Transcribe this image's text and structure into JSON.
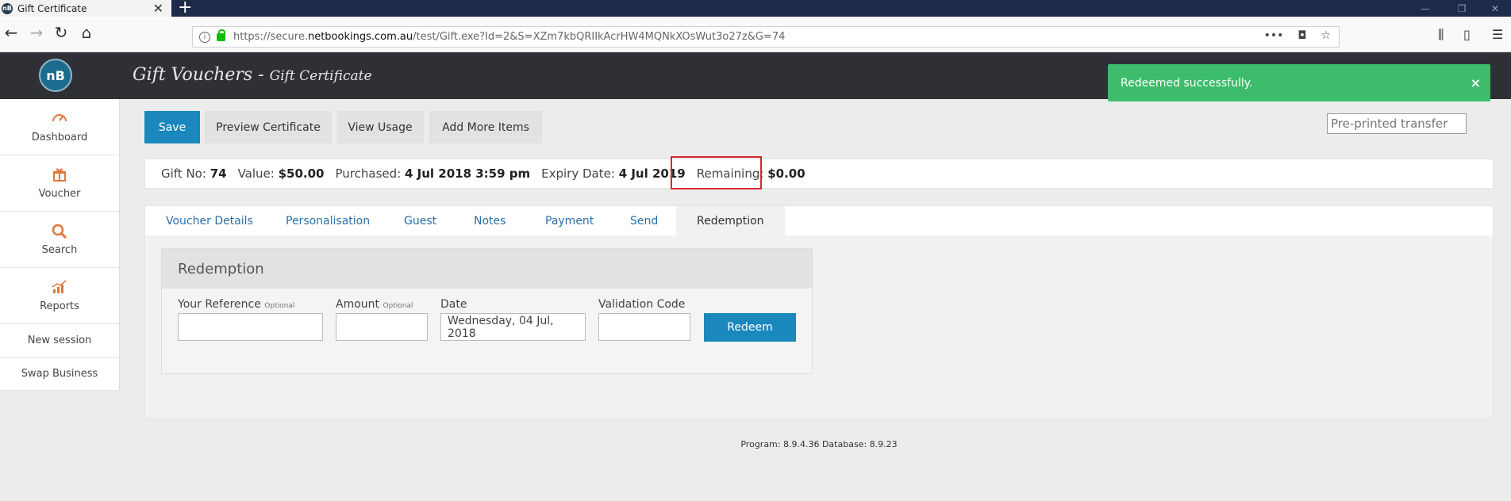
{
  "browser": {
    "tab_title": "Gift Certificate",
    "url_prefix": "https://secure.",
    "url_domain": "netbookings.com.au",
    "url_path": "/test/Gift.exe?Id=2&S=XZm7kbQRIIkAcrHW4MQNkXOsWut3o27z&G=74"
  },
  "header": {
    "logo_text": "nB",
    "title": "Gift Vouchers - ",
    "subtitle": "Gift Certificate"
  },
  "toast": {
    "message": "Redeemed successfully.",
    "close": "×"
  },
  "sidebar": {
    "items": [
      {
        "label": "Dashboard",
        "icon": "dashboard-icon"
      },
      {
        "label": "Voucher",
        "icon": "gift-icon"
      },
      {
        "label": "Search",
        "icon": "search-icon"
      },
      {
        "label": "Reports",
        "icon": "chart-icon"
      }
    ],
    "links": [
      "New session",
      "Swap Business"
    ]
  },
  "toolbar": {
    "save": "Save",
    "preview": "Preview Certificate",
    "usage": "View Usage",
    "add_items": "Add More Items",
    "preprinted_placeholder": "Pre-printed transfer"
  },
  "info": {
    "gift_no_label": "Gift No:",
    "gift_no": "74",
    "value_label": "Value:",
    "value": "$50.00",
    "purchased_label": "Purchased:",
    "purchased": "4 Jul 2018 3:59 pm",
    "expiry_label": "Expiry Date:",
    "expiry": "4 Jul 2019",
    "remaining_label": "Remaining:",
    "remaining": "$0.00"
  },
  "tabs": [
    "Voucher Details",
    "Personalisation",
    "Guest",
    "Notes",
    "Payment",
    "Send",
    "Redemption"
  ],
  "redemption": {
    "heading": "Redemption",
    "reference_label": "Your Reference",
    "reference_hint": "Optional",
    "amount_label": "Amount",
    "amount_hint": "Optional",
    "date_label": "Date",
    "date_value": "Wednesday, 04 Jul, 2018",
    "validation_label": "Validation Code",
    "redeem_button": "Redeem"
  },
  "footer": {
    "version": "Program: 8.9.4.36 Database: 8.9.23"
  }
}
